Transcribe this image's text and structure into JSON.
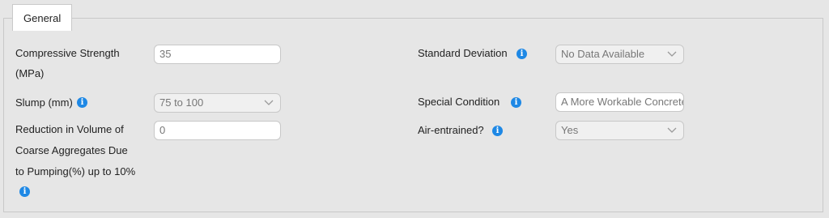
{
  "tab": {
    "label": "General"
  },
  "fields": {
    "compressive_strength": {
      "label_line1": "Compressive Strength",
      "label_line2": "(MPa)",
      "value": "35"
    },
    "slump": {
      "label": "Slump (mm)",
      "value": "75 to 100"
    },
    "reduction": {
      "label_line1": "Reduction in Volume of",
      "label_line2": "Coarse Aggregates Due",
      "label_line3": "to Pumping(%) up to 10%",
      "value": "0"
    },
    "standard_deviation": {
      "label": "Standard Deviation",
      "value": "No Data Available"
    },
    "special_condition": {
      "label": "Special Condition",
      "value": "A More Workable Concrete"
    },
    "air_entrained": {
      "label": "Air-entrained?",
      "value": "Yes"
    }
  },
  "icons": {
    "info": "info-icon",
    "chevron": "chevron-down-icon",
    "info_color": "#1e88e5"
  }
}
